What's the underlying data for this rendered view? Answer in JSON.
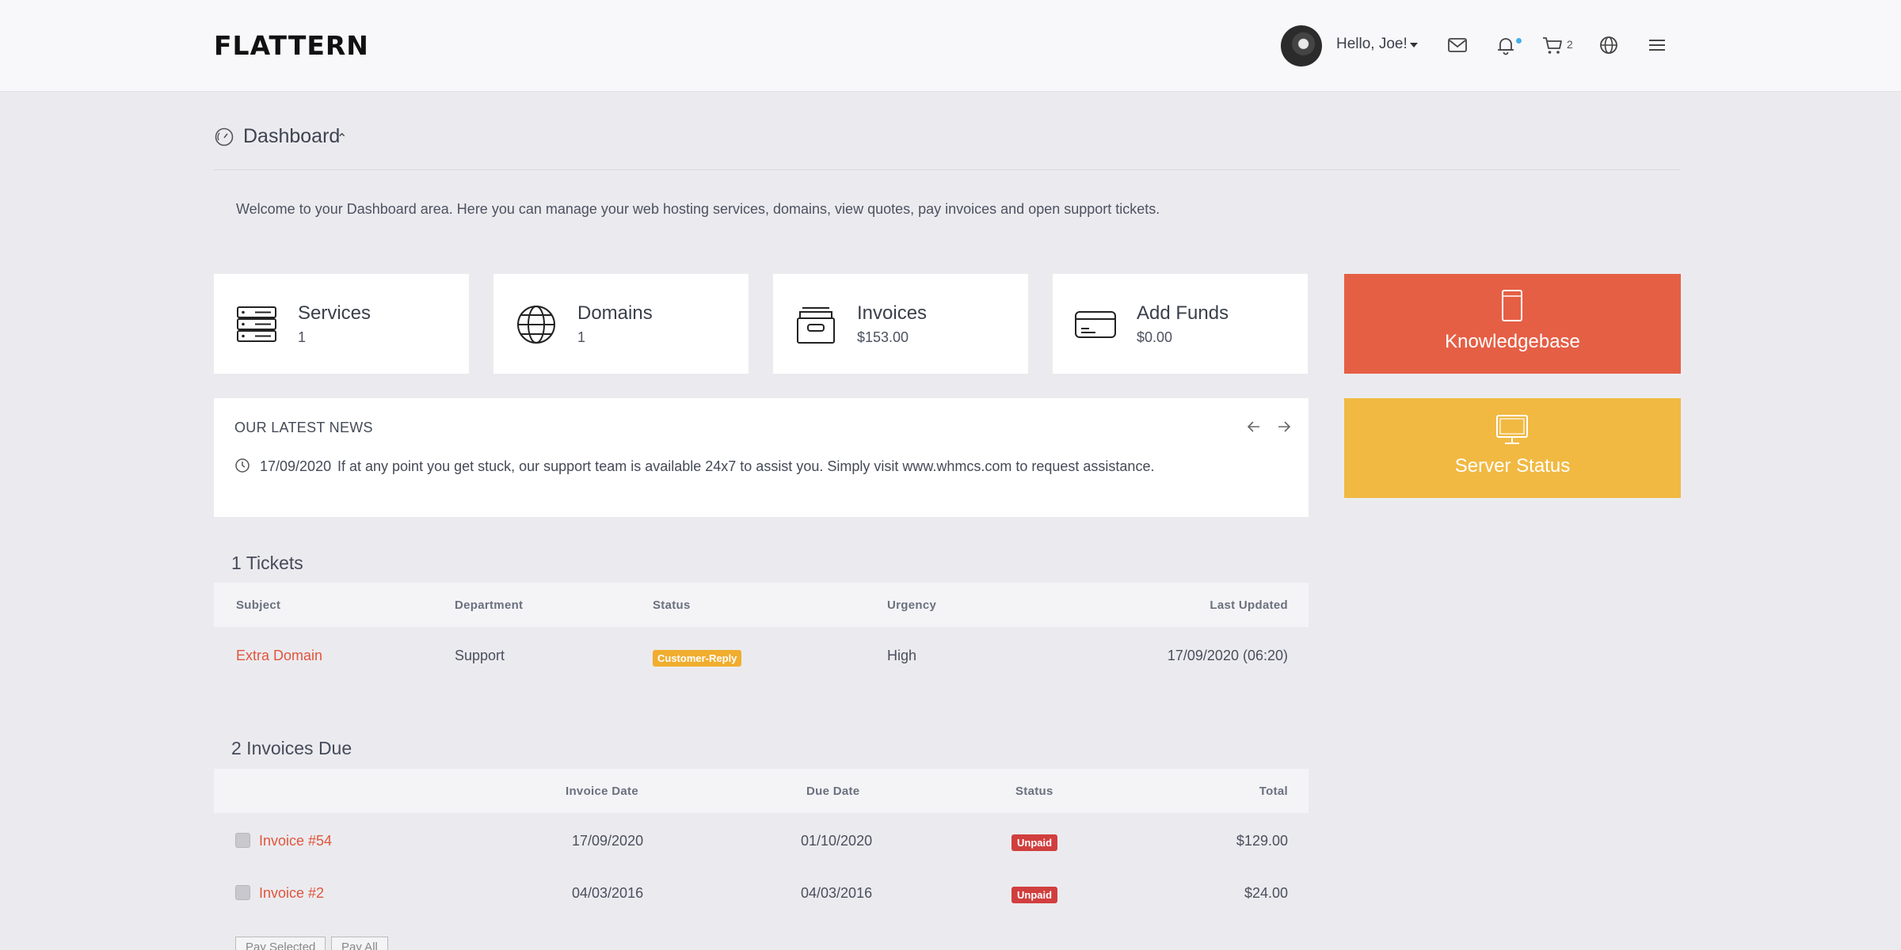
{
  "header": {
    "logo": "FLATTERN",
    "greeting": "Hello, Joe!",
    "cart_count": "2"
  },
  "dashboard": {
    "title": "Dashboard",
    "welcome": "Welcome to your Dashboard area. Here you can manage your web hosting services, domains, view quotes, pay invoices and open support tickets."
  },
  "stats": [
    {
      "title": "Services",
      "value": "1"
    },
    {
      "title": "Domains",
      "value": "1"
    },
    {
      "title": "Invoices",
      "value": "$153.00"
    },
    {
      "title": "Add Funds",
      "value": "$0.00"
    }
  ],
  "tiles": {
    "knowledgebase": "Knowledgebase",
    "server_status": "Server Status"
  },
  "colors": {
    "accent_red": "#e55f45",
    "accent_yellow": "#f1b942",
    "link": "#e0553c"
  },
  "news": {
    "title": "OUR LATEST NEWS",
    "date": "17/09/2020",
    "text": "If at any point you get stuck, our support team is available 24x7 to assist you. Simply visit www.whmcs.com to request assistance."
  },
  "tickets": {
    "title": "1 Tickets",
    "headers": [
      "Subject",
      "Department",
      "Status",
      "Urgency",
      "Last Updated"
    ],
    "rows": [
      {
        "subject": "Extra Domain",
        "department": "Support",
        "status": "Customer-Reply",
        "urgency": "High",
        "updated": "17/09/2020 (06:20)"
      }
    ]
  },
  "invoices": {
    "title": "2 Invoices Due",
    "headers": [
      "Invoice Date",
      "Due Date",
      "Status",
      "Total"
    ],
    "rows": [
      {
        "id": "Invoice #54",
        "date": "17/09/2020",
        "due": "01/10/2020",
        "status": "Unpaid",
        "total": "$129.00"
      },
      {
        "id": "Invoice #2",
        "date": "04/03/2016",
        "due": "04/03/2016",
        "status": "Unpaid",
        "total": "$24.00"
      }
    ],
    "pay_selected": "Pay Selected",
    "pay_all": "Pay All"
  }
}
